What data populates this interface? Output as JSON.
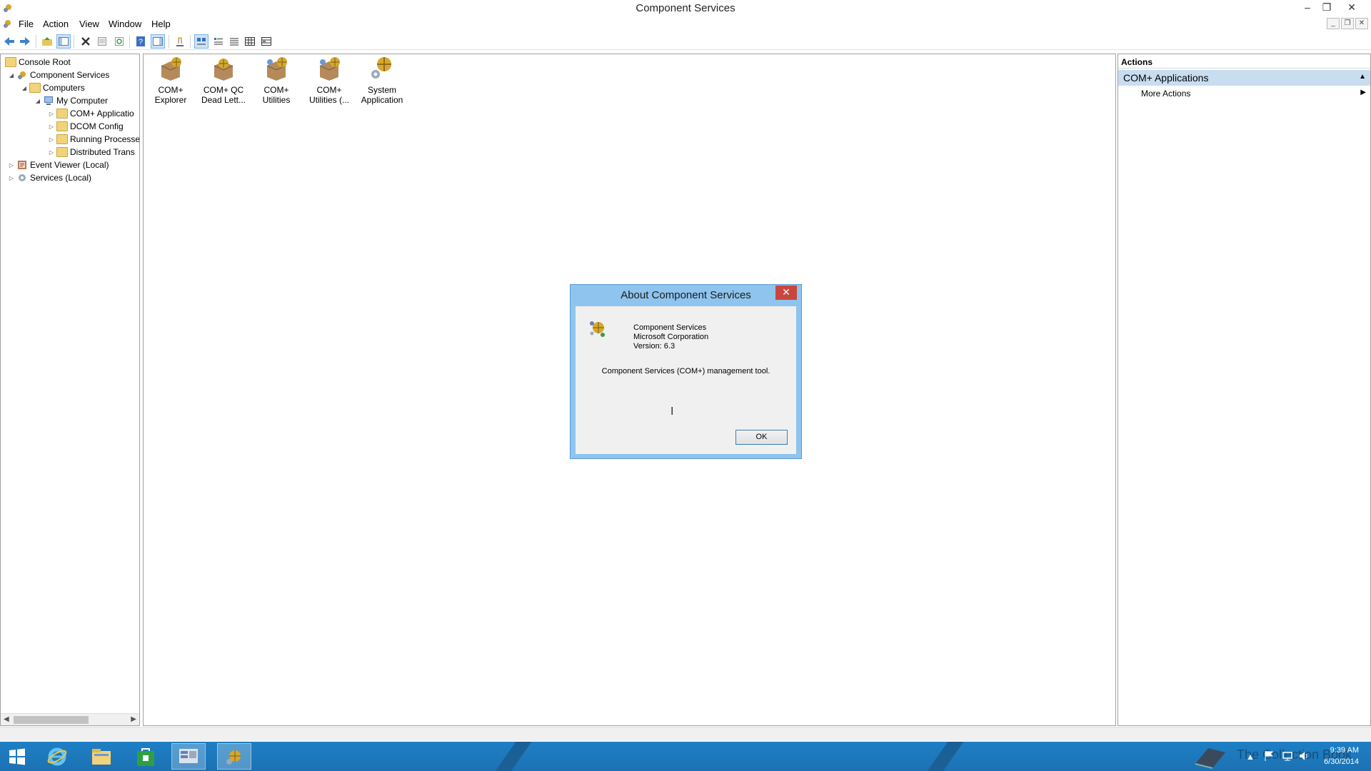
{
  "window": {
    "title": "Component Services",
    "controls": {
      "minimize": "–",
      "restore": "❐",
      "close": "✕"
    }
  },
  "menu": [
    "File",
    "Action",
    "View",
    "Window",
    "Help"
  ],
  "tree": {
    "items": [
      {
        "label": "Console Root"
      },
      {
        "label": "Component Services"
      },
      {
        "label": "Computers"
      },
      {
        "label": "My Computer"
      },
      {
        "label": "COM+ Applicatio"
      },
      {
        "label": "DCOM Config"
      },
      {
        "label": "Running Processe"
      },
      {
        "label": "Distributed Trans"
      },
      {
        "label": "Event Viewer (Local)"
      },
      {
        "label": "Services (Local)"
      }
    ]
  },
  "center": {
    "items": [
      {
        "line1": "COM+",
        "line2": "Explorer"
      },
      {
        "line1": "COM+ QC",
        "line2": "Dead Lett..."
      },
      {
        "line1": "COM+",
        "line2": "Utilities"
      },
      {
        "line1": "COM+",
        "line2": "Utilities (..."
      },
      {
        "line1": "System",
        "line2": "Application"
      }
    ]
  },
  "actions": {
    "header": "Actions",
    "section": "COM+ Applications",
    "more": "More Actions"
  },
  "dialog": {
    "title": "About Component Services",
    "product": "Component Services",
    "company": "Microsoft Corporation",
    "version": "Version: 6.3",
    "description": "Component Services (COM+) management tool.",
    "ok": "OK"
  },
  "taskbar": {
    "watermark": "The Collection Book",
    "time": "9:39 AM",
    "date": "6/30/2014"
  },
  "colors": {
    "accent": "#1e7fc5",
    "dialog_frame": "#8ec4ee",
    "selected_section": "#c9ddf1"
  }
}
